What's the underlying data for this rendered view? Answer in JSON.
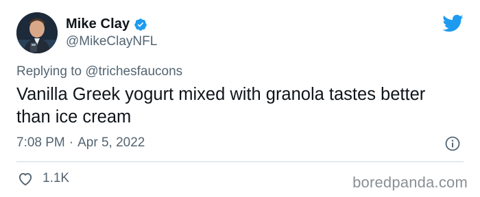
{
  "author": {
    "display_name": "Mike Clay",
    "handle": "@MikeClayNFL",
    "verified": true,
    "avatar_icon": "profile-photo"
  },
  "reply": {
    "prefix": "Replying to",
    "target": "@trichesfaucons"
  },
  "tweet": {
    "text": "Vanilla Greek yogurt mixed with granola tastes better than ice cream",
    "time": "7:08 PM",
    "separator": "·",
    "date": "Apr 5, 2022"
  },
  "actions": {
    "likes": "1.1K",
    "like_icon": "heart-icon",
    "info_icon": "info-icon"
  },
  "brand": {
    "logo_icon": "twitter-bird-icon",
    "logo_color": "#1d9bf0",
    "verified_color": "#1d9bf0"
  },
  "watermark": {
    "text": "boredpanda.com"
  }
}
